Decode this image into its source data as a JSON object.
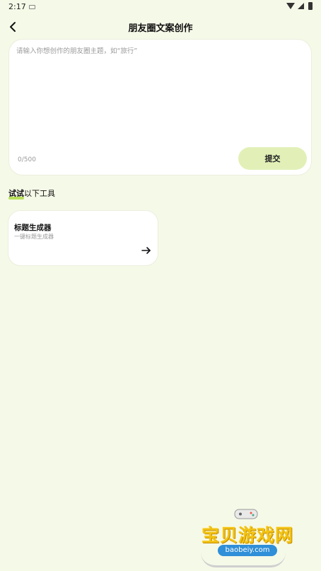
{
  "status_bar": {
    "time": "2:17",
    "icons": [
      "keyboard-icon",
      "wifi-icon",
      "signal-icon",
      "battery-icon"
    ]
  },
  "app_bar": {
    "title": "朋友圈文案创作",
    "back_icon": "chevron-left-icon"
  },
  "composer": {
    "placeholder": "请输入你想创作的朋友圈主题，如“旅行”",
    "value": "",
    "char_count": "0/500",
    "submit_label": "提交"
  },
  "tools_section": {
    "heading_highlight": "试试",
    "heading_rest": "以下工具",
    "tools": [
      {
        "title": "标题生成器",
        "description": "一键标题生成器",
        "icon": "arrow-right-icon"
      }
    ]
  },
  "watermark": {
    "logo_text": "宝贝游戏网",
    "url": "baobeiy.com"
  },
  "colors": {
    "background": "#f5f9e8",
    "accent": "#e2f0b8",
    "highlight": "#b9e05a"
  }
}
